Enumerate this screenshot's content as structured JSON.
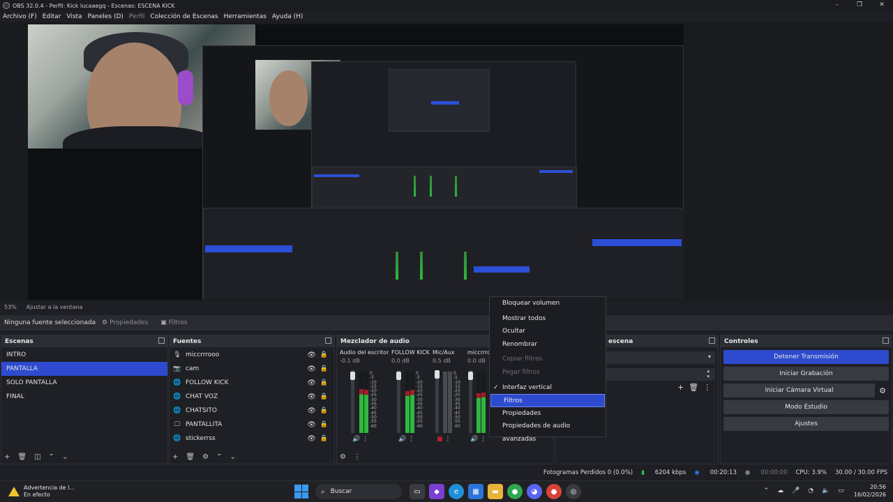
{
  "window": {
    "title": "OBS 32.0.4 - Perfil: Kick lucaaegq - Escenas: ESCENA KICK",
    "minimize": "–",
    "maximize": "❐",
    "close": "✕"
  },
  "menu": [
    "Archivo (F)",
    "Editar",
    "Vista",
    "Paneles (D)",
    "Perfil",
    "Colección de Escenas",
    "Herramientas",
    "Ayuda (H)"
  ],
  "status_line": {
    "zoom": "53%",
    "fit": "Ajustar a la ventana"
  },
  "props_bar": {
    "no_source": "Ninguna fuente seleccionada",
    "properties": "Propiedades",
    "filters": "Filtros"
  },
  "scenes": {
    "title": "Escenas",
    "items": [
      "INTRO",
      "PANTALLA",
      "SOLO PANTALLA",
      "FINAL"
    ],
    "active_index": 1
  },
  "sources": {
    "title": "Fuentes",
    "items": [
      {
        "name": "miccrrrooo",
        "icon": "mic-icon"
      },
      {
        "name": "cam",
        "icon": "camera-icon"
      },
      {
        "name": "FOLLOW KICK",
        "icon": "globe-icon"
      },
      {
        "name": "CHAT VOZ",
        "icon": "globe-icon"
      },
      {
        "name": "CHATSITO",
        "icon": "globe-icon"
      },
      {
        "name": "PANTALLITA",
        "icon": "monitor-icon"
      },
      {
        "name": "stickerrss",
        "icon": "globe-icon"
      }
    ]
  },
  "mixer": {
    "title": "Mezclador de audio",
    "channels": [
      {
        "name": "Audio del escritorio",
        "db": "-0.1 dB",
        "level": 0.72
      },
      {
        "name": "FOLLOW KICK",
        "db": "0.0 dB",
        "level": 0.7
      },
      {
        "name": "Mic/Aux",
        "db": "0.5 dB",
        "level": 0.0,
        "muted": true
      },
      {
        "name": "miccrrrooo",
        "db": "0.0 dB",
        "level": 0.65
      }
    ],
    "scale": [
      "0",
      "-5",
      "-10",
      "-15",
      "-20",
      "-25",
      "-30",
      "-35",
      "-40",
      "-45",
      "-50",
      "-55",
      "-60"
    ]
  },
  "transitions": {
    "title": "escena"
  },
  "controls": {
    "title": "Controles",
    "buttons": [
      "Detener Transmisión",
      "Iniciar Grabación",
      "Iniciar Cámara Virtual",
      "Modo Estudio",
      "Ajustes"
    ]
  },
  "context_menu": {
    "items": [
      {
        "label": "Bloquear volumen"
      },
      {
        "label": "Mostrar todos"
      },
      {
        "label": "Ocultar"
      },
      {
        "label": "Renombrar"
      },
      {
        "label": "Copiar filtros",
        "disabled": true
      },
      {
        "label": "Pegar filtros",
        "disabled": true
      },
      {
        "label": "Interfaz vertical",
        "checked": true
      },
      {
        "label": "Filtros",
        "selected": true
      },
      {
        "label": "Propiedades"
      },
      {
        "label": "Propiedades de audio avanzadas"
      }
    ]
  },
  "statusbar": {
    "dropped": "Fotogramas Perdidos 0 (0.0%)",
    "bitrate": "6204 kbps",
    "live_time": "00:20:13",
    "rec_time": "00:00:00",
    "cpu": "CPU: 3.9%",
    "fps": "30.00 / 30.00 FPS"
  },
  "taskbar": {
    "warning_title": "Advertencia de l...",
    "warning_sub": "En efecto",
    "search": "Buscar",
    "time": "20:56",
    "date": "16/02/2026"
  },
  "colors": {
    "accent": "#2e4bcf",
    "panel": "#1f2025",
    "meter_green": "#2db83f",
    "meter_red": "#a01c2b"
  }
}
